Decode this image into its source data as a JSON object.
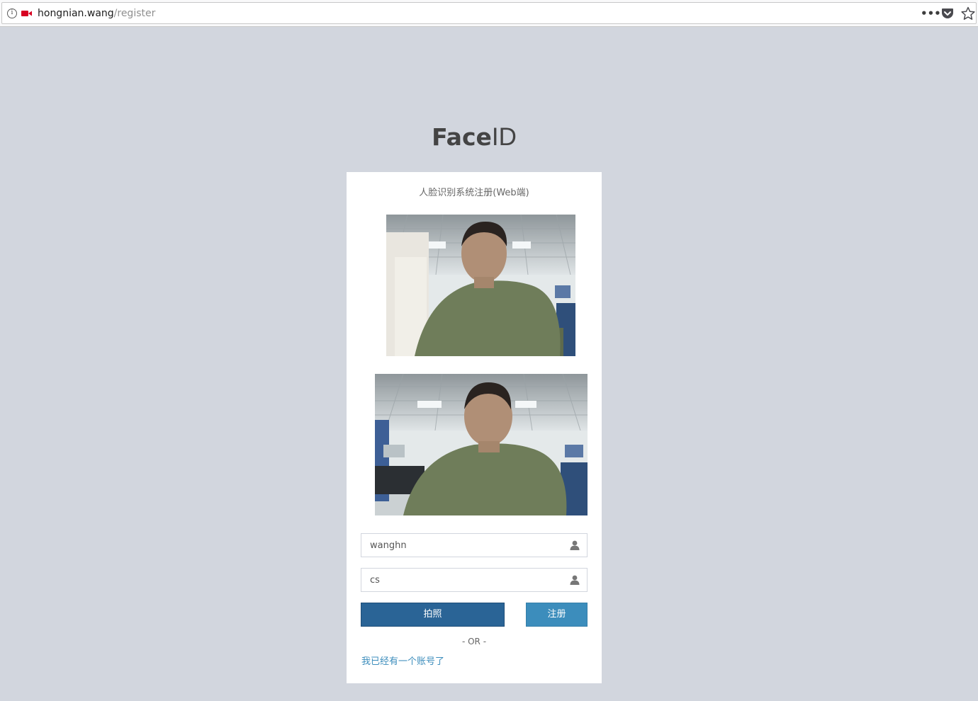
{
  "browser": {
    "url_host": "hongnian.wang",
    "url_path": "/register",
    "more_label": "•••"
  },
  "logo": {
    "bold": "Face",
    "light": "ID"
  },
  "card": {
    "title": "人脸识别系统注册(Web端)",
    "username": {
      "value": "wanghn"
    },
    "group": {
      "value": "cs"
    },
    "buttons": {
      "photo_label": "拍照",
      "register_label": "注册"
    },
    "divider": "- OR -",
    "login_link": "我已经有一个账号了"
  },
  "colors": {
    "page_bg": "#d2d6de",
    "primary_dark": "#2a6496",
    "primary": "#3c8dbc"
  },
  "icons": {
    "user_field_icon": "user-icon",
    "address_icon": "info-icon",
    "camera_indicator": "camera-icon"
  }
}
